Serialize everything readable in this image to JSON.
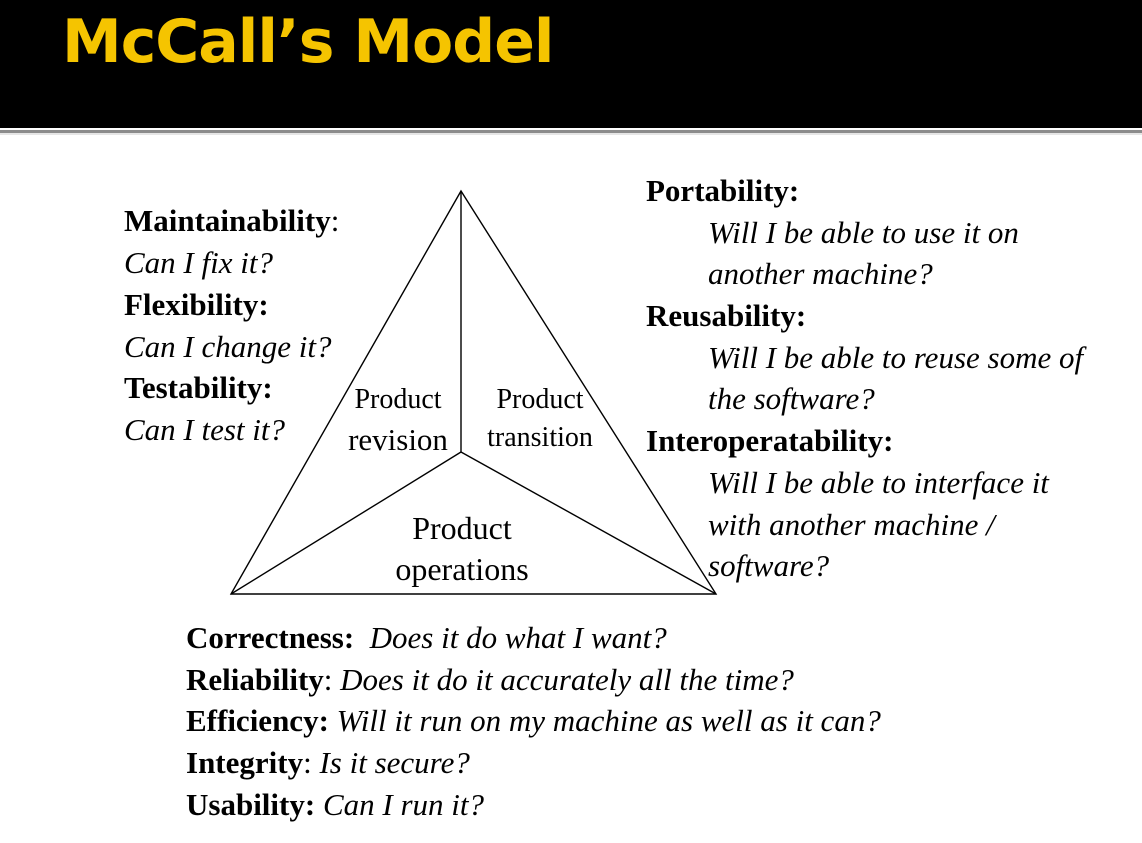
{
  "slide": {
    "title": "McCall’s Model"
  },
  "triangle": {
    "revision": [
      "Product",
      "revision"
    ],
    "transition": [
      "Product",
      "transition"
    ],
    "operations": [
      "Product",
      "operations"
    ]
  },
  "left": [
    {
      "name": "Maintainability",
      "punct": ":",
      "question": "Can I fix it?"
    },
    {
      "name": "Flexibility:",
      "question": "Can I change it?"
    },
    {
      "name": "Testability:",
      "question": "Can I test it?"
    }
  ],
  "right": [
    {
      "name": "Portability:",
      "lines": [
        "Will I be able to use it on",
        "another machine?"
      ]
    },
    {
      "name": "Reusability:",
      "lines": [
        "Will I be able to reuse some of",
        "the software?"
      ]
    },
    {
      "name": "Interoperatability:",
      "lines": [
        "Will I be able to interface it",
        "with another machine /",
        "software?"
      ]
    }
  ],
  "bottom": [
    {
      "name": "Correctness:",
      "sep": "  ",
      "question": "Does it do what I want?"
    },
    {
      "name": "Reliability",
      "sep": ": ",
      "question": "Does it do it accurately all the time?"
    },
    {
      "name": "Efficiency:",
      "sep": " ",
      "question": "Will it run on my machine as well as it can?"
    },
    {
      "name": "Integrity",
      "sep": ": ",
      "question": "Is it secure?"
    },
    {
      "name": "Usability:",
      "sep": " ",
      "question": "Can I run it?"
    }
  ]
}
